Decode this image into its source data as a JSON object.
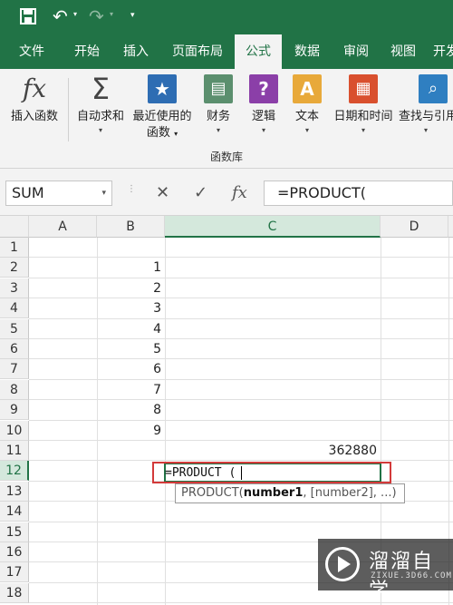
{
  "colors": {
    "accent": "#217346",
    "highlight": "#d33a3a"
  },
  "tabs": [
    "文件",
    "开始",
    "插入",
    "页面布局",
    "公式",
    "数据",
    "审阅",
    "视图",
    "开发"
  ],
  "active_tab": "公式",
  "ribbon": {
    "insert_function": "插入函数",
    "autosum": "自动求和",
    "recent": "最近使用的",
    "recent_line2": "函数",
    "financial": "财务",
    "logical": "逻辑",
    "text": "文本",
    "datetime": "日期和时间",
    "lookup": "查找与引用",
    "group_label": "函数库"
  },
  "formula_bar": {
    "name_box": "SUM",
    "formula": "=PRODUCT(",
    "fx_symbol": "fx",
    "cancel_symbol": "✕",
    "enter_symbol": "✓"
  },
  "columns": [
    "A",
    "B",
    "C",
    "D"
  ],
  "rows": [
    "1",
    "2",
    "3",
    "4",
    "5",
    "6",
    "7",
    "8",
    "9",
    "10",
    "11",
    "12",
    "13",
    "14",
    "15",
    "16",
    "17",
    "18"
  ],
  "column_b_values": [
    "1",
    "2",
    "3",
    "4",
    "5",
    "6",
    "7",
    "8",
    "9"
  ],
  "c11_value": "362880",
  "active_cell": {
    "editing_text": "=PRODUCT (",
    "tooltip_prefix": "PRODUCT(",
    "tooltip_bold": "number1",
    "tooltip_suffix": ", [number2], ...)"
  },
  "watermark": {
    "title": "溜溜自学",
    "subtitle": "ZIXUE.3D66.COM"
  }
}
